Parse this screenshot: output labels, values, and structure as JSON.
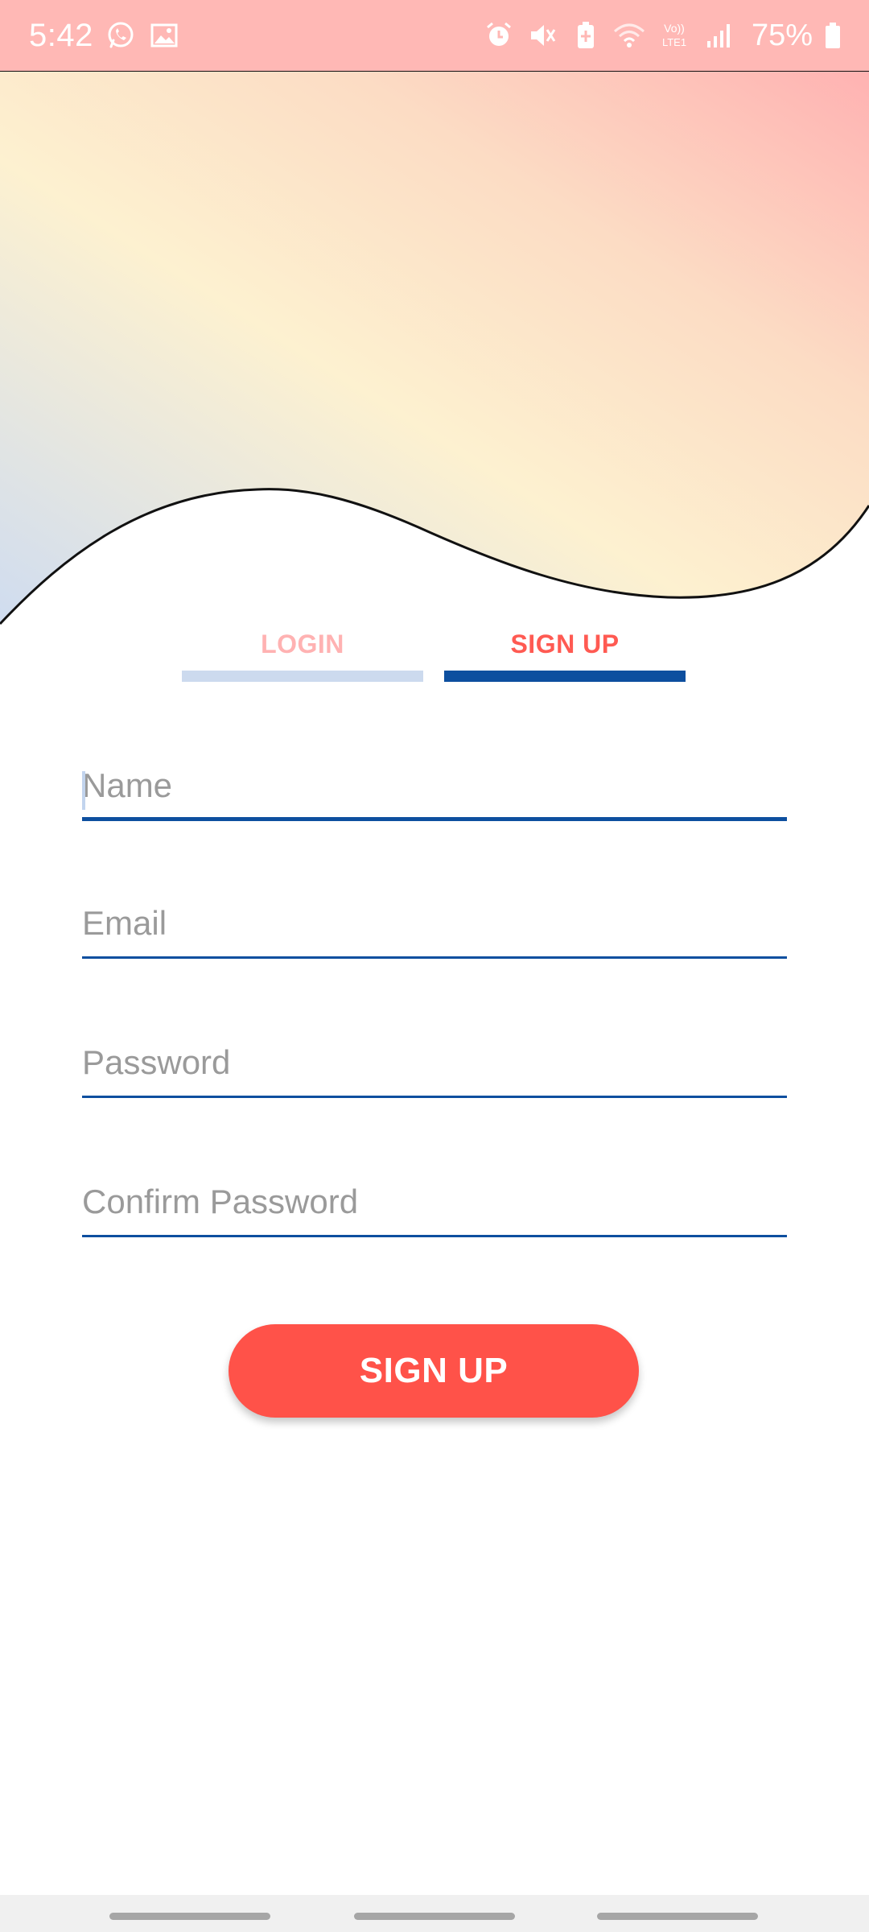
{
  "status_bar": {
    "time": "5:42",
    "battery": "75%",
    "network_label": "Vo))\nLTE1",
    "left_icons": [
      "whatsapp-icon",
      "gallery-icon"
    ],
    "right_icons": [
      "alarm-icon",
      "mute-icon",
      "battery-saver-icon",
      "wifi-icon",
      "volte-icon",
      "signal-icon",
      "battery-icon"
    ]
  },
  "colors": {
    "status_bar_bg": "#ffb8b5",
    "accent_red": "#ff5249",
    "accent_blue": "#0d4f9f",
    "inactive_tab_text": "#ffb2b2",
    "inactive_tab_bar": "#ccdaee",
    "hero_gradient": [
      "#cfdcf0",
      "#fdf1d0",
      "#fcdcc4",
      "#ffb2b2"
    ]
  },
  "tabs": [
    {
      "label": "LOGIN",
      "active": false
    },
    {
      "label": "SIGN UP",
      "active": true
    }
  ],
  "form": {
    "fields": [
      {
        "placeholder": "Name",
        "value": "",
        "focused": true
      },
      {
        "placeholder": "Email",
        "value": "",
        "focused": false
      },
      {
        "placeholder": "Password",
        "value": "",
        "focused": false
      },
      {
        "placeholder": "Confirm Password",
        "value": "",
        "focused": false
      }
    ],
    "submit_label": "SIGN UP"
  },
  "nav_bar": {
    "buttons": [
      "recents-button",
      "home-button",
      "back-button"
    ]
  }
}
